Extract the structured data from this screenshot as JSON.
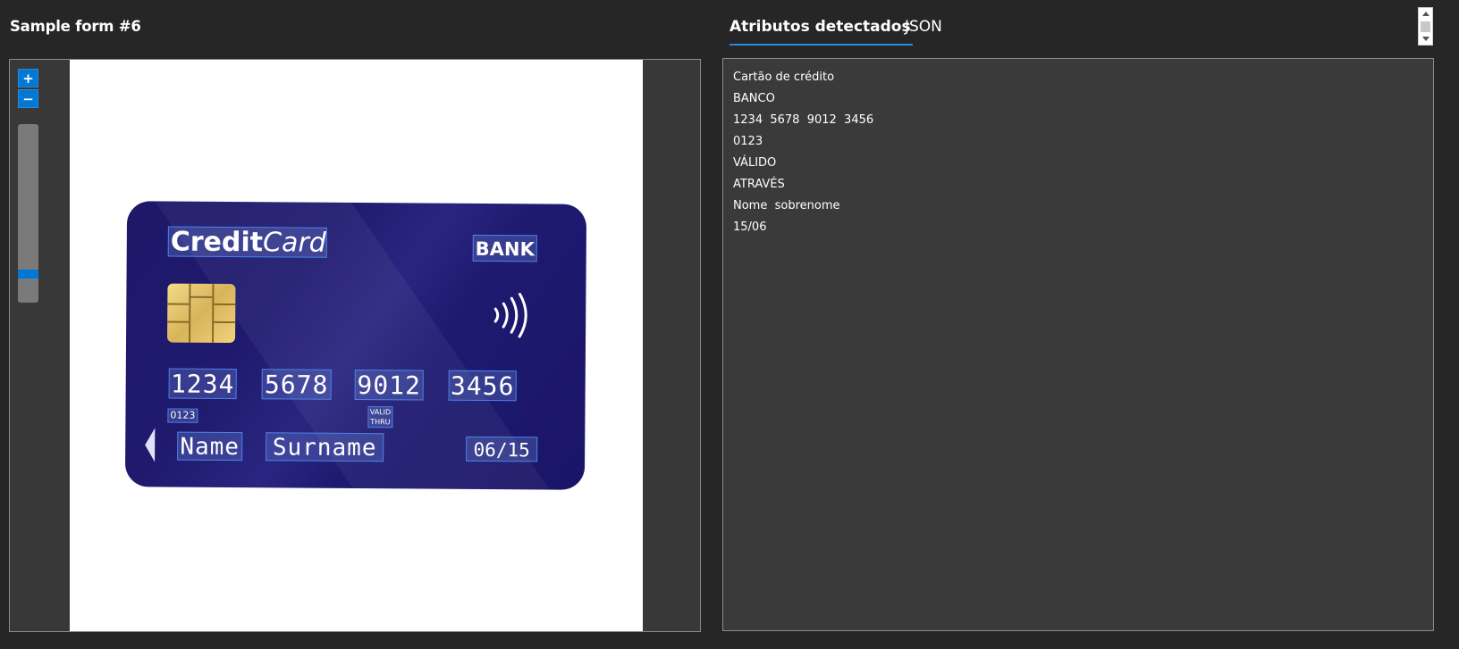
{
  "header": {
    "title": "Sample form #6"
  },
  "zoom": {
    "zoom_in_label": "+",
    "zoom_out_label": "−",
    "level": 0.1
  },
  "card": {
    "brand_bold": "Credit",
    "brand_italic": "Card",
    "bank": "BANK",
    "numbers": [
      "1234",
      "5678",
      "9012",
      "3456"
    ],
    "code": "0123",
    "valid_line1": "VALID",
    "valid_line2": "THRU",
    "first_name": "Name",
    "last_name": "Surname",
    "date": "06/15"
  },
  "tabs": [
    {
      "label": "Atributos detectados",
      "active": true
    },
    {
      "label": "JSON",
      "active": false
    }
  ],
  "attributes": [
    "Cartão de crédito",
    "BANCO",
    "1234  5678  9012  3456",
    "0123",
    "VÁLIDO",
    "ATRAVÉS",
    "Nome  sobrenome",
    "15/06"
  ],
  "colors": {
    "accent": "#0078d4",
    "tab_underline": "#2b88d8",
    "highlight_box": "#4a82e6",
    "card_blue": "#1d1868"
  }
}
